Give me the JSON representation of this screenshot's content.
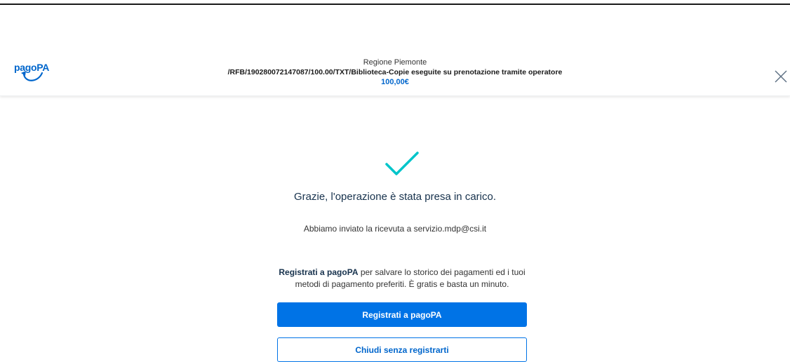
{
  "header": {
    "logo_text": "pagoPA",
    "ente": "Regione Piemonte",
    "causale": "/RFB/190280072147087/100.00/TXT/Biblioteca-Copie eseguite su prenotazione tramite operatore",
    "importo": "100,00€"
  },
  "result": {
    "icon": "check-icon",
    "title": "Grazie, l'operazione è stata presa in carico.",
    "email_message": "Abbiamo inviato la ricevuta a servizio.mdp@csi.it"
  },
  "register": {
    "bold_text": "Registrati a pagoPA",
    "message_rest": " per salvare lo storico dei pagamenti ed i tuoi metodi di pagamento preferiti. È gratis e basta un minuto.",
    "primary_button": "Registrati a pagoPA",
    "secondary_button": "Chiudi senza registrarti"
  },
  "colors": {
    "accent": "#0073e6",
    "check": "#00c5ca",
    "text": "#17324d"
  }
}
